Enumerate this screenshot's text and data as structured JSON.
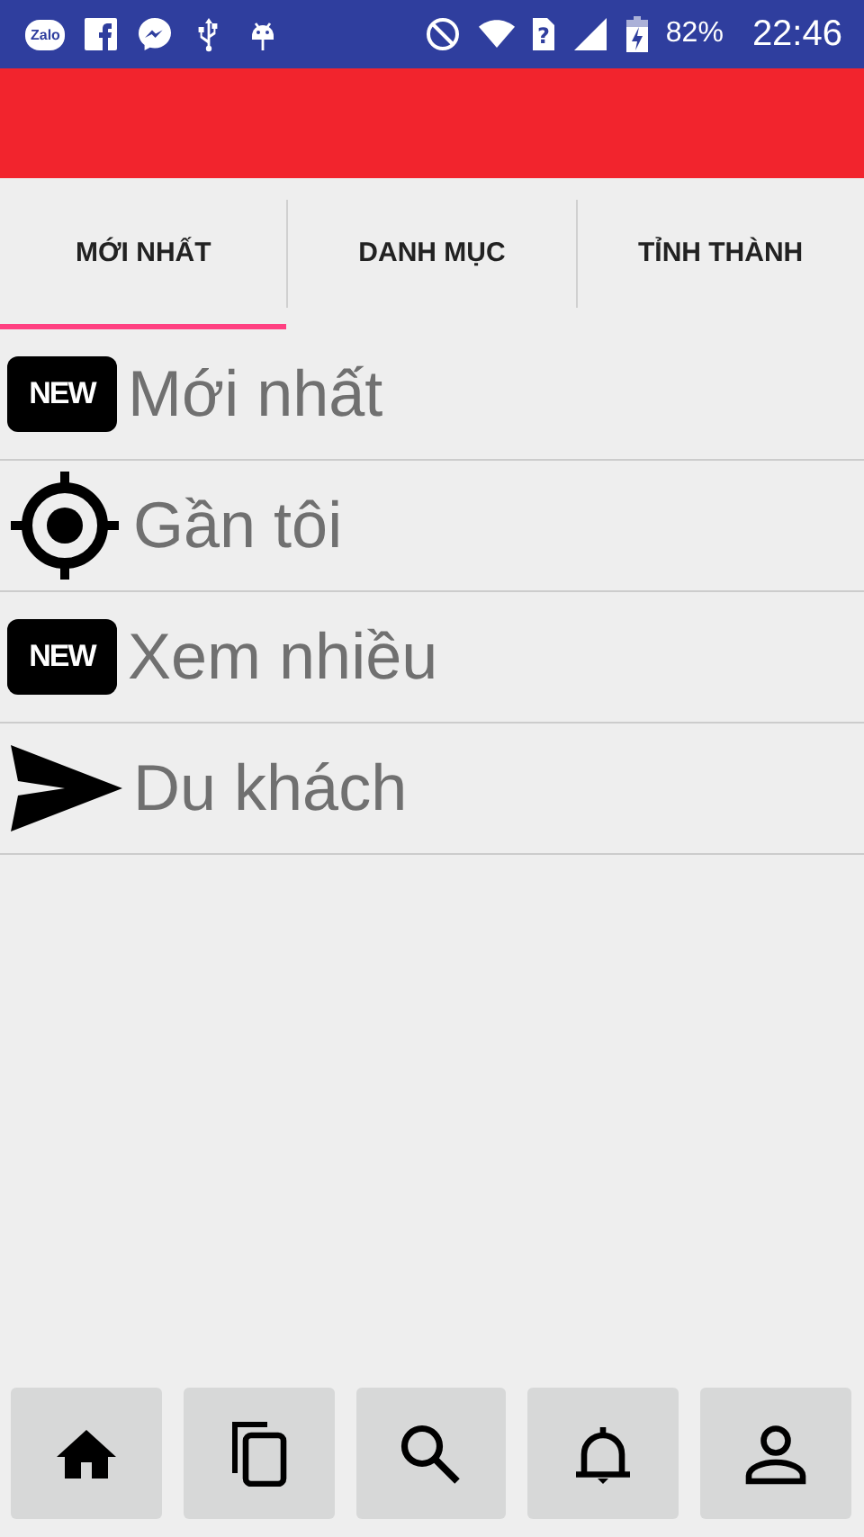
{
  "status_bar": {
    "zalo": "Zalo",
    "sim": "?",
    "battery": "82%",
    "time": "22:46"
  },
  "tabs": [
    {
      "label": "MỚI NHẤT",
      "selected": true
    },
    {
      "label": "DANH MỤC",
      "selected": false
    },
    {
      "label": "TỈNH THÀNH",
      "selected": false
    }
  ],
  "items": [
    {
      "kind": "new",
      "badge": "NEW",
      "label": "Mới nhất"
    },
    {
      "kind": "target",
      "label": "Gần tôi"
    },
    {
      "kind": "new",
      "badge": "NEW",
      "label": "Xem nhiều"
    },
    {
      "kind": "send",
      "label": "Du khách"
    }
  ],
  "bottom_nav": [
    {
      "kind": "home"
    },
    {
      "kind": "copy"
    },
    {
      "kind": "search"
    },
    {
      "kind": "bell"
    },
    {
      "kind": "person"
    }
  ]
}
